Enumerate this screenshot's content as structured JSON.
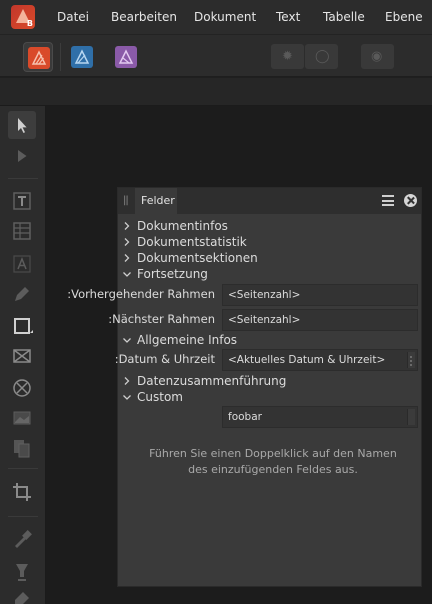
{
  "menu": {
    "logo_letter": "B",
    "items": [
      "Datei",
      "Bearbeiten",
      "Dokument",
      "Text",
      "Tabelle",
      "Ebene"
    ]
  },
  "toolbar": {
    "personas": [
      "publisher-persona-icon",
      "designer-persona-icon",
      "photo-persona-icon"
    ],
    "colors": {
      "publisher": "#d94a2a",
      "designer": "#2f6fa8",
      "photo": "#8a5aa8"
    }
  },
  "tools": [
    "move-tool-icon",
    "node-tool-icon",
    "frame-text-tool-icon",
    "table-tool-icon",
    "artistic-text-tool-icon",
    "pen-tool-icon",
    "rectangle-tool-icon",
    "picture-frame-tool-icon",
    "ellipse-frame-tool-icon",
    "image-placer-icon",
    "pages-icon",
    "crop-tool-icon",
    "eyedropper-tool-icon",
    "fill-tool-icon",
    "vector-brush-tool-icon"
  ],
  "panel": {
    "tab": "Felder",
    "sections": {
      "docinfo": "Dokumentinfos",
      "docstats": "Dokumentstatistik",
      "docsections": "Dokumentsektionen",
      "continuation": "Fortsetzung",
      "general": "Allgemeine Infos",
      "merge": "Datenzusammenführung",
      "custom": "Custom"
    },
    "fields": {
      "prev_frame_label": "Vorhergehender Rahmen:",
      "prev_frame_value": "<Seitenzahl>",
      "next_frame_label": "Nächster Rahmen:",
      "next_frame_value": "<Seitenzahl>",
      "datetime_label": "Datum & Uhrzeit:",
      "datetime_value": "<Aktuelles Datum & Uhrzeit>",
      "custom_value": "foobar"
    },
    "help": "Führen Sie einen Doppelklick auf den Namen des einzufügenden Feldes aus."
  }
}
